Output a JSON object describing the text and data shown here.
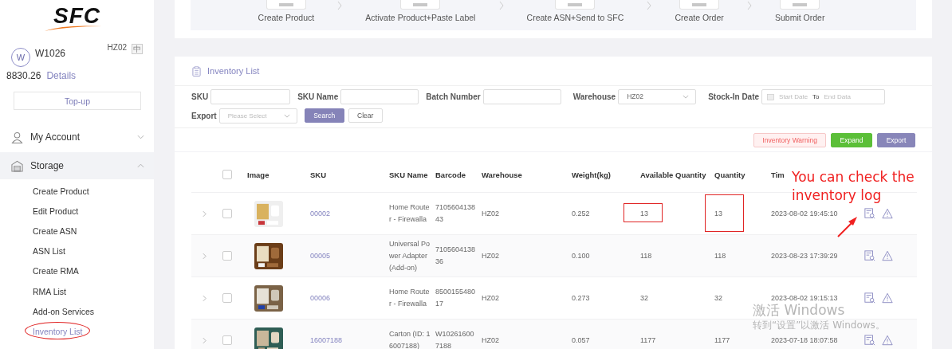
{
  "sidebar": {
    "logo": "SFC",
    "user": {
      "avatar": "W",
      "name": "W1026",
      "warehouse": "HZ02",
      "lang": "中",
      "balance": "8830.26",
      "details_link": "Details",
      "topup_button": "Top-up"
    },
    "menu": [
      {
        "label": "My Account",
        "expanded": false,
        "selected": false
      },
      {
        "label": "Storage",
        "expanded": true,
        "selected": true,
        "children": [
          {
            "label": "Create Product",
            "selected": false
          },
          {
            "label": "Edit Product",
            "selected": false
          },
          {
            "label": "Create ASN",
            "selected": false
          },
          {
            "label": "ASN List",
            "selected": false
          },
          {
            "label": "Create RMA",
            "selected": false
          },
          {
            "label": "RMA List",
            "selected": false
          },
          {
            "label": "Add-on Services",
            "selected": false
          },
          {
            "label": "Inventory List",
            "selected": true
          }
        ]
      }
    ]
  },
  "steps": [
    "Create Product",
    "Activate Product+Paste Label",
    "Create ASN+Send to SFC",
    "Create Order",
    "Submit Order"
  ],
  "inventory": {
    "title": "Inventory List",
    "filters": {
      "sku": {
        "label": "SKU"
      },
      "sku_name": {
        "label": "SKU Name"
      },
      "batch_number": {
        "label": "Batch Number"
      },
      "warehouse": {
        "label": "Warehouse",
        "value": "HZ02"
      },
      "stock_in_date": {
        "label": "Stock-In Date",
        "start_placeholder": "Start Date",
        "separator": "To",
        "end_placeholder": "End Data"
      },
      "export": {
        "label": "Export",
        "placeholder": "Please Select"
      }
    },
    "search_button": "Search",
    "clear_button": "Clear",
    "toolbar": [
      "Inventory Warning",
      "Expand",
      "Export"
    ],
    "table": {
      "all_checked": false,
      "columns": [
        "Image",
        "SKU",
        "SKU Name",
        "Barcode",
        "Warehouse",
        "Weight(kg)",
        "Available Quantity",
        "Quantity",
        "Tim"
      ],
      "rows": [
        {
          "checked": false,
          "sku": "00002",
          "sku_name": "Home Router - Firewalla",
          "barcode": "710560413843",
          "warehouse": "HZ02",
          "weight": "0.252",
          "available": "13",
          "quantity": "13",
          "time": "2023-08-02 19:45:10"
        },
        {
          "checked": false,
          "sku": "00005",
          "sku_name": "Universal Power Adapter (Add-on)",
          "barcode": "710560413836",
          "warehouse": "HZ02",
          "weight": "0.100",
          "available": "118",
          "quantity": "118",
          "time": "2023-08-23 17:39:29"
        },
        {
          "checked": false,
          "sku": "00006",
          "sku_name": "Home Router - Firewalla",
          "barcode": "850015548017",
          "warehouse": "HZ02",
          "weight": "0.273",
          "available": "32",
          "quantity": "32",
          "time": "2023-08-02 19:15:13"
        },
        {
          "checked": false,
          "sku": "16007188",
          "sku_name": "Carton (ID: 16007188)",
          "barcode": "W102616007188",
          "warehouse": "HZ02",
          "weight": "0.057",
          "available": "1177",
          "quantity": "1177",
          "time": "2023-07-18 18:07:58"
        }
      ]
    }
  },
  "annotation": {
    "text": "You can check the inventory log"
  },
  "os_notice": {
    "title": "激活 Windows",
    "subtitle": "转到“设置”以激活 Windows。"
  }
}
